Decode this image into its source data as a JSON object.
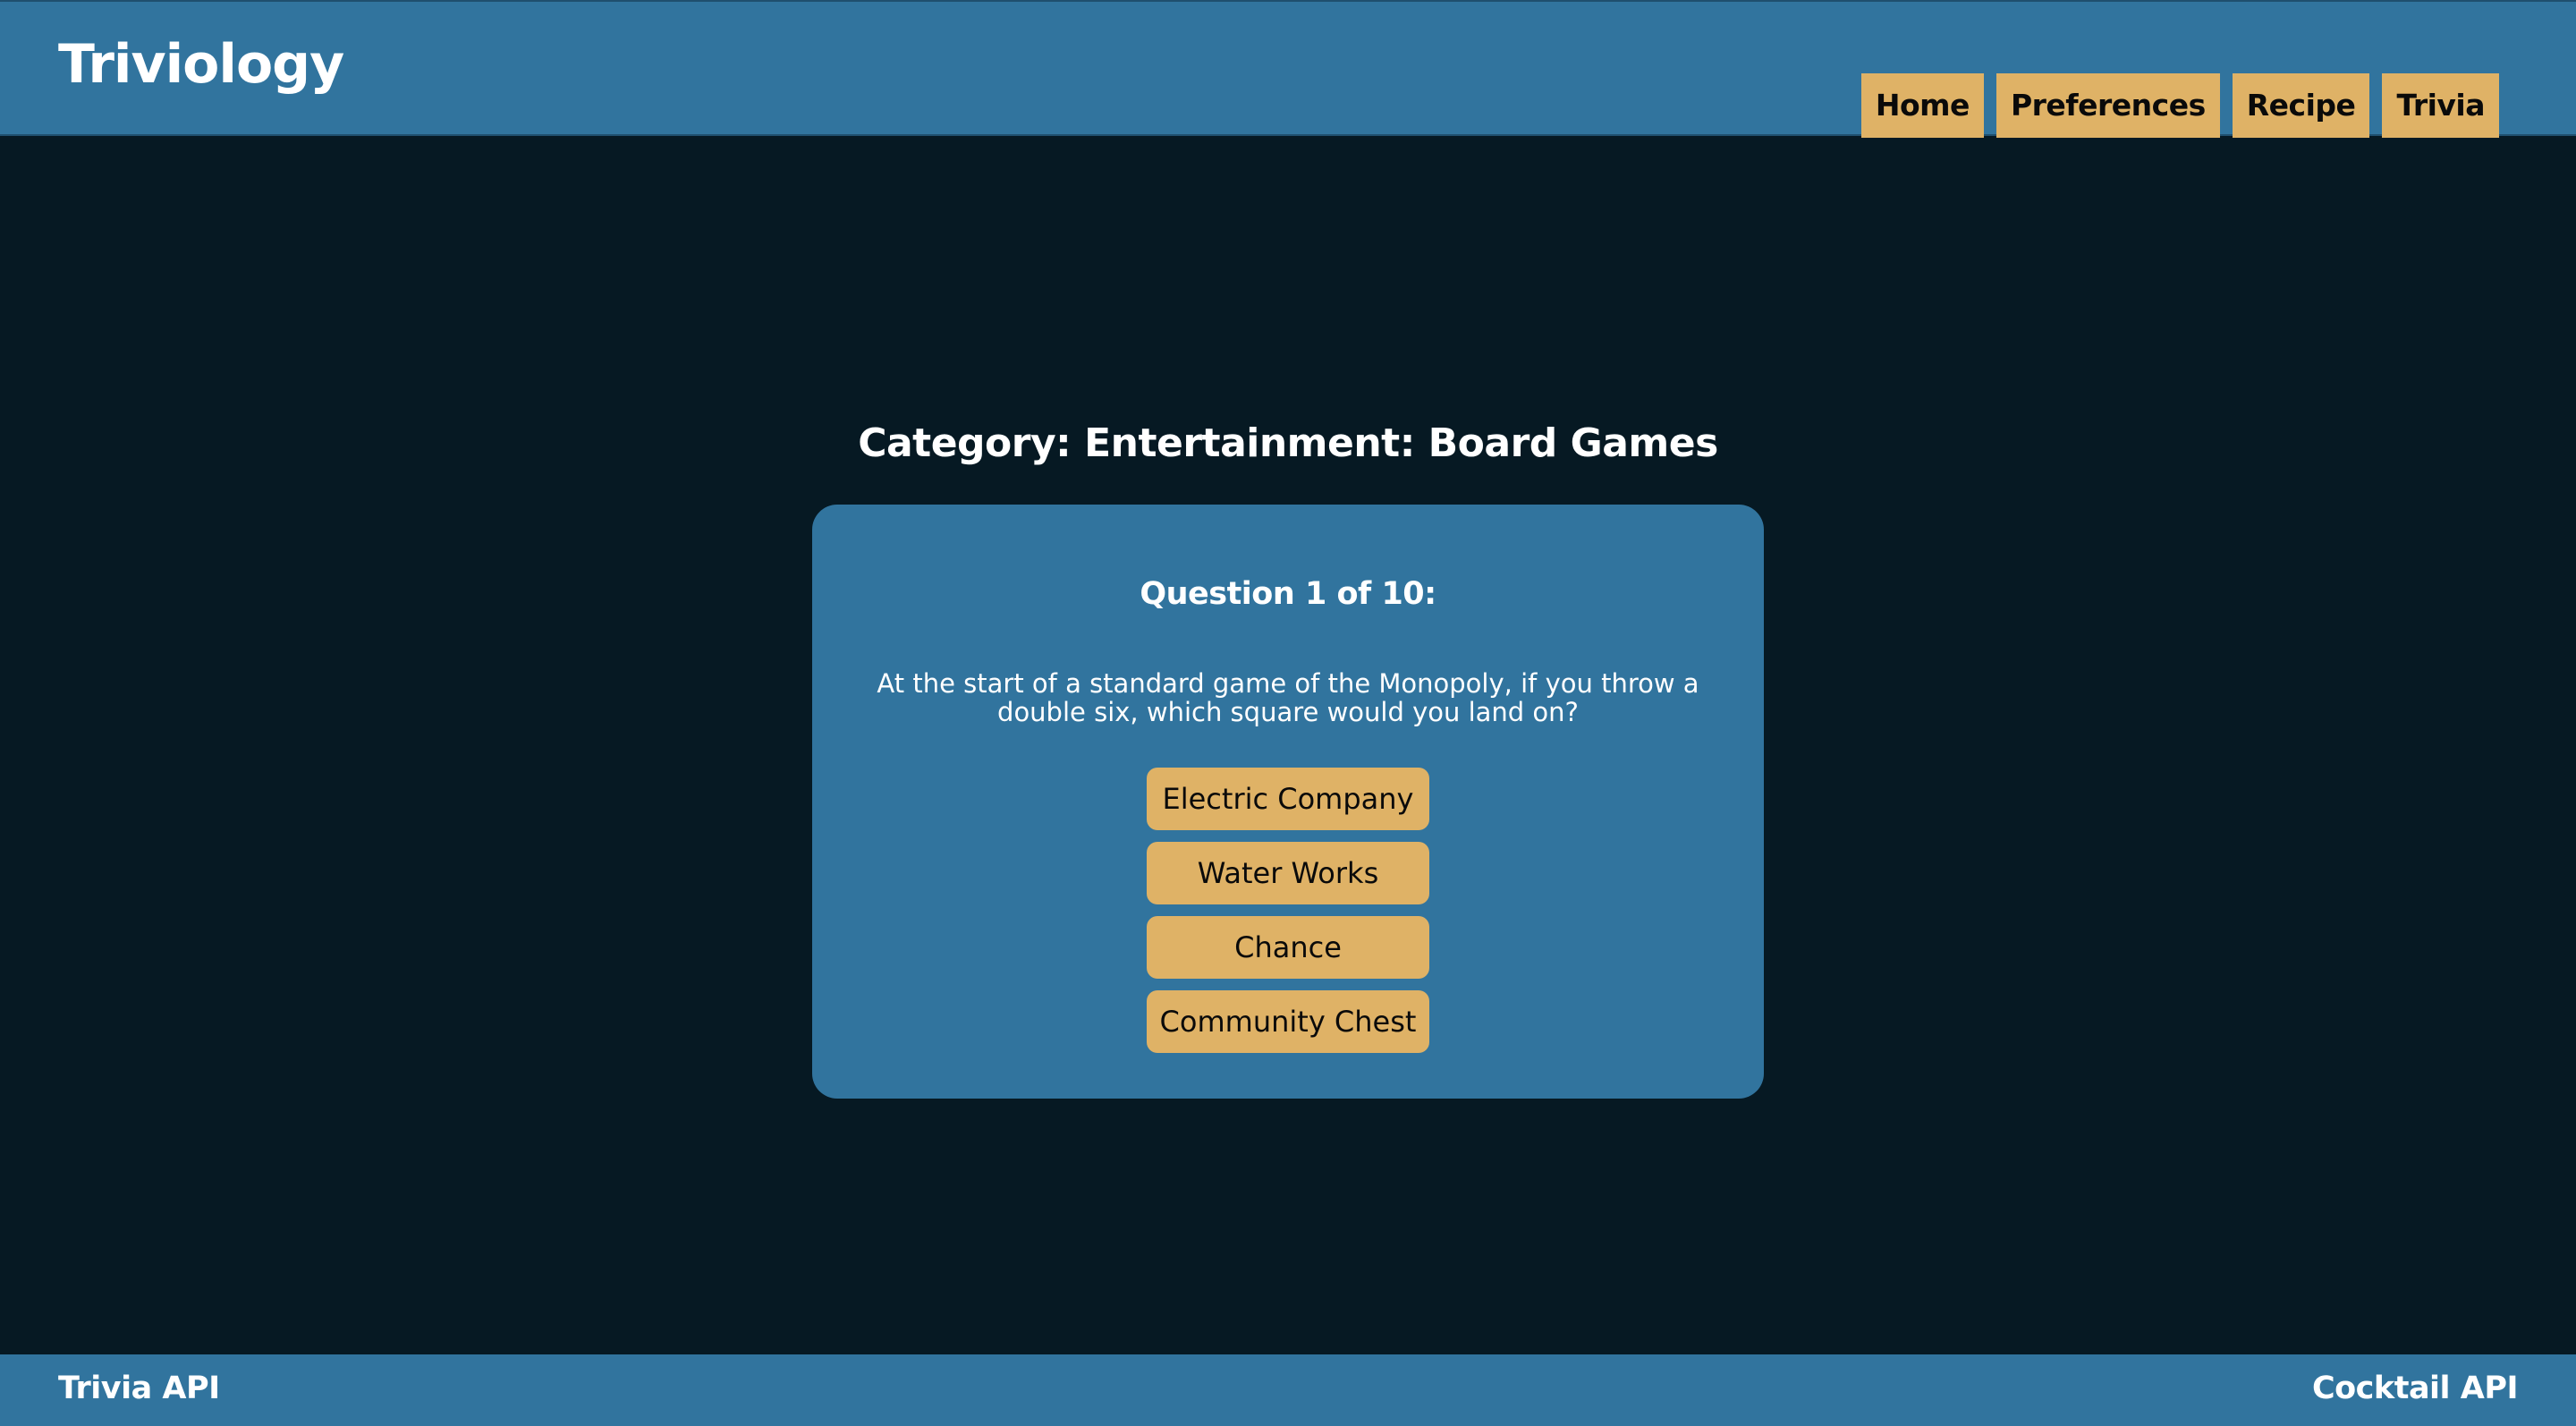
{
  "header": {
    "brand": "Triviology",
    "nav": [
      "Home",
      "Preferences",
      "Recipe",
      "Trivia"
    ]
  },
  "quiz": {
    "category": "Category: Entertainment: Board Games",
    "question_number": "Question 1 of 10:",
    "question_text": "At the start of a standard game of the Monopoly, if you throw a double six, which square would you land on?",
    "answers": [
      "Electric Company",
      "Water Works",
      "Chance",
      "Community Chest"
    ]
  },
  "footer": {
    "left_link": "Trivia API",
    "right_link": "Cocktail API"
  },
  "colors": {
    "bar_blue": "#31749e",
    "background": "#061923",
    "button_gold": "#dfb266"
  }
}
